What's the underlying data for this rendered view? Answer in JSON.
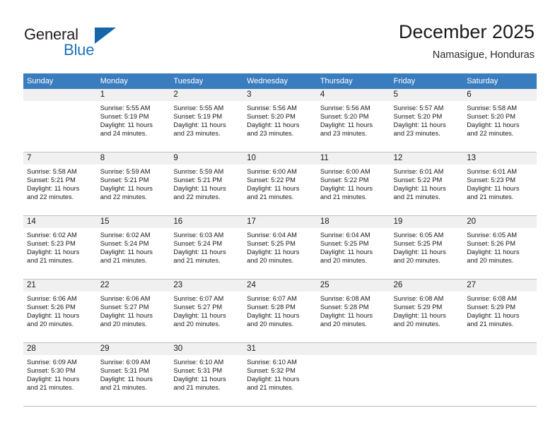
{
  "brand": {
    "name_part1": "General",
    "name_part2": "Blue",
    "triangle_color": "#1565a8",
    "blue_text_color": "#1d72b8"
  },
  "header": {
    "title": "December 2025",
    "subtitle": "Namasigue, Honduras",
    "header_bg_color": "#3a7dbe",
    "day_band_color": "#f0f0f0"
  },
  "weekday_headers": [
    "Sunday",
    "Monday",
    "Tuesday",
    "Wednesday",
    "Thursday",
    "Friday",
    "Saturday"
  ],
  "weeks": [
    [
      {
        "day": "",
        "sunrise": "",
        "sunset": "",
        "daylight1": "",
        "daylight2": ""
      },
      {
        "day": "1",
        "sunrise": "Sunrise: 5:55 AM",
        "sunset": "Sunset: 5:19 PM",
        "daylight1": "Daylight: 11 hours",
        "daylight2": "and 24 minutes."
      },
      {
        "day": "2",
        "sunrise": "Sunrise: 5:55 AM",
        "sunset": "Sunset: 5:19 PM",
        "daylight1": "Daylight: 11 hours",
        "daylight2": "and 23 minutes."
      },
      {
        "day": "3",
        "sunrise": "Sunrise: 5:56 AM",
        "sunset": "Sunset: 5:20 PM",
        "daylight1": "Daylight: 11 hours",
        "daylight2": "and 23 minutes."
      },
      {
        "day": "4",
        "sunrise": "Sunrise: 5:56 AM",
        "sunset": "Sunset: 5:20 PM",
        "daylight1": "Daylight: 11 hours",
        "daylight2": "and 23 minutes."
      },
      {
        "day": "5",
        "sunrise": "Sunrise: 5:57 AM",
        "sunset": "Sunset: 5:20 PM",
        "daylight1": "Daylight: 11 hours",
        "daylight2": "and 23 minutes."
      },
      {
        "day": "6",
        "sunrise": "Sunrise: 5:58 AM",
        "sunset": "Sunset: 5:20 PM",
        "daylight1": "Daylight: 11 hours",
        "daylight2": "and 22 minutes."
      }
    ],
    [
      {
        "day": "7",
        "sunrise": "Sunrise: 5:58 AM",
        "sunset": "Sunset: 5:21 PM",
        "daylight1": "Daylight: 11 hours",
        "daylight2": "and 22 minutes."
      },
      {
        "day": "8",
        "sunrise": "Sunrise: 5:59 AM",
        "sunset": "Sunset: 5:21 PM",
        "daylight1": "Daylight: 11 hours",
        "daylight2": "and 22 minutes."
      },
      {
        "day": "9",
        "sunrise": "Sunrise: 5:59 AM",
        "sunset": "Sunset: 5:21 PM",
        "daylight1": "Daylight: 11 hours",
        "daylight2": "and 22 minutes."
      },
      {
        "day": "10",
        "sunrise": "Sunrise: 6:00 AM",
        "sunset": "Sunset: 5:22 PM",
        "daylight1": "Daylight: 11 hours",
        "daylight2": "and 21 minutes."
      },
      {
        "day": "11",
        "sunrise": "Sunrise: 6:00 AM",
        "sunset": "Sunset: 5:22 PM",
        "daylight1": "Daylight: 11 hours",
        "daylight2": "and 21 minutes."
      },
      {
        "day": "12",
        "sunrise": "Sunrise: 6:01 AM",
        "sunset": "Sunset: 5:22 PM",
        "daylight1": "Daylight: 11 hours",
        "daylight2": "and 21 minutes."
      },
      {
        "day": "13",
        "sunrise": "Sunrise: 6:01 AM",
        "sunset": "Sunset: 5:23 PM",
        "daylight1": "Daylight: 11 hours",
        "daylight2": "and 21 minutes."
      }
    ],
    [
      {
        "day": "14",
        "sunrise": "Sunrise: 6:02 AM",
        "sunset": "Sunset: 5:23 PM",
        "daylight1": "Daylight: 11 hours",
        "daylight2": "and 21 minutes."
      },
      {
        "day": "15",
        "sunrise": "Sunrise: 6:02 AM",
        "sunset": "Sunset: 5:24 PM",
        "daylight1": "Daylight: 11 hours",
        "daylight2": "and 21 minutes."
      },
      {
        "day": "16",
        "sunrise": "Sunrise: 6:03 AM",
        "sunset": "Sunset: 5:24 PM",
        "daylight1": "Daylight: 11 hours",
        "daylight2": "and 21 minutes."
      },
      {
        "day": "17",
        "sunrise": "Sunrise: 6:04 AM",
        "sunset": "Sunset: 5:25 PM",
        "daylight1": "Daylight: 11 hours",
        "daylight2": "and 20 minutes."
      },
      {
        "day": "18",
        "sunrise": "Sunrise: 6:04 AM",
        "sunset": "Sunset: 5:25 PM",
        "daylight1": "Daylight: 11 hours",
        "daylight2": "and 20 minutes."
      },
      {
        "day": "19",
        "sunrise": "Sunrise: 6:05 AM",
        "sunset": "Sunset: 5:25 PM",
        "daylight1": "Daylight: 11 hours",
        "daylight2": "and 20 minutes."
      },
      {
        "day": "20",
        "sunrise": "Sunrise: 6:05 AM",
        "sunset": "Sunset: 5:26 PM",
        "daylight1": "Daylight: 11 hours",
        "daylight2": "and 20 minutes."
      }
    ],
    [
      {
        "day": "21",
        "sunrise": "Sunrise: 6:06 AM",
        "sunset": "Sunset: 5:26 PM",
        "daylight1": "Daylight: 11 hours",
        "daylight2": "and 20 minutes."
      },
      {
        "day": "22",
        "sunrise": "Sunrise: 6:06 AM",
        "sunset": "Sunset: 5:27 PM",
        "daylight1": "Daylight: 11 hours",
        "daylight2": "and 20 minutes."
      },
      {
        "day": "23",
        "sunrise": "Sunrise: 6:07 AM",
        "sunset": "Sunset: 5:27 PM",
        "daylight1": "Daylight: 11 hours",
        "daylight2": "and 20 minutes."
      },
      {
        "day": "24",
        "sunrise": "Sunrise: 6:07 AM",
        "sunset": "Sunset: 5:28 PM",
        "daylight1": "Daylight: 11 hours",
        "daylight2": "and 20 minutes."
      },
      {
        "day": "25",
        "sunrise": "Sunrise: 6:08 AM",
        "sunset": "Sunset: 5:28 PM",
        "daylight1": "Daylight: 11 hours",
        "daylight2": "and 20 minutes."
      },
      {
        "day": "26",
        "sunrise": "Sunrise: 6:08 AM",
        "sunset": "Sunset: 5:29 PM",
        "daylight1": "Daylight: 11 hours",
        "daylight2": "and 20 minutes."
      },
      {
        "day": "27",
        "sunrise": "Sunrise: 6:08 AM",
        "sunset": "Sunset: 5:29 PM",
        "daylight1": "Daylight: 11 hours",
        "daylight2": "and 21 minutes."
      }
    ],
    [
      {
        "day": "28",
        "sunrise": "Sunrise: 6:09 AM",
        "sunset": "Sunset: 5:30 PM",
        "daylight1": "Daylight: 11 hours",
        "daylight2": "and 21 minutes."
      },
      {
        "day": "29",
        "sunrise": "Sunrise: 6:09 AM",
        "sunset": "Sunset: 5:31 PM",
        "daylight1": "Daylight: 11 hours",
        "daylight2": "and 21 minutes."
      },
      {
        "day": "30",
        "sunrise": "Sunrise: 6:10 AM",
        "sunset": "Sunset: 5:31 PM",
        "daylight1": "Daylight: 11 hours",
        "daylight2": "and 21 minutes."
      },
      {
        "day": "31",
        "sunrise": "Sunrise: 6:10 AM",
        "sunset": "Sunset: 5:32 PM",
        "daylight1": "Daylight: 11 hours",
        "daylight2": "and 21 minutes."
      },
      {
        "day": "",
        "sunrise": "",
        "sunset": "",
        "daylight1": "",
        "daylight2": ""
      },
      {
        "day": "",
        "sunrise": "",
        "sunset": "",
        "daylight1": "",
        "daylight2": ""
      },
      {
        "day": "",
        "sunrise": "",
        "sunset": "",
        "daylight1": "",
        "daylight2": ""
      }
    ]
  ]
}
